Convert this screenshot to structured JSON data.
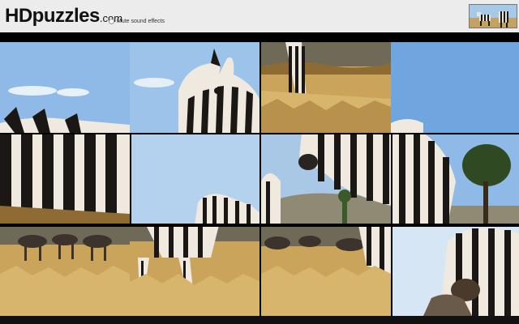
{
  "header": {
    "logo_main": "HDpuzzles",
    "logo_tld": ".com",
    "mute_label": "Mute sound effects"
  },
  "colors": {
    "sky": "#9cc3ea",
    "sky_light": "#d6e6f4",
    "grass": "#c9a45a",
    "grass_dark": "#8e6b33",
    "stripe_dark": "#1a1714",
    "stripe_light": "#efe9df",
    "tree": "#2f4a22",
    "hill": "#8f8a74"
  },
  "tiles": [
    {
      "name": "tile-r1c1",
      "kind": "zebra-body"
    },
    {
      "name": "tile-r1c2",
      "kind": "zebra-head-ear"
    },
    {
      "name": "tile-r1c3",
      "kind": "grass-legs"
    },
    {
      "name": "tile-r1c4",
      "kind": "blue-sky"
    },
    {
      "name": "tile-r2c1",
      "kind": "zebra-flank"
    },
    {
      "name": "tile-r2c2",
      "kind": "sky-foal"
    },
    {
      "name": "tile-r2c3",
      "kind": "zebra-snout"
    },
    {
      "name": "tile-r2c4",
      "kind": "tree"
    },
    {
      "name": "tile-r3c1",
      "kind": "wildebeest-herd"
    },
    {
      "name": "tile-r3c2",
      "kind": "grazing-zebra"
    },
    {
      "name": "tile-r3c3",
      "kind": "herd-grass"
    },
    {
      "name": "tile-r3c4",
      "kind": "zebra-closeup"
    }
  ]
}
